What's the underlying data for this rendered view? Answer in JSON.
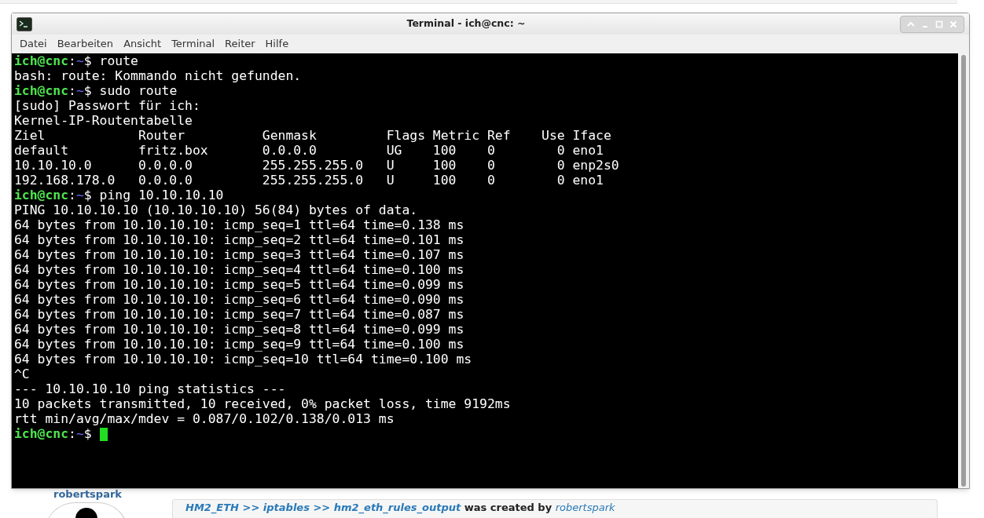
{
  "window": {
    "title": "Terminal - ich@cnc: ~"
  },
  "menu": [
    "Datei",
    "Bearbeiten",
    "Ansicht",
    "Terminal",
    "Reiter",
    "Hilfe"
  ],
  "terminal": {
    "lines": [
      {
        "kind": "prompt",
        "userhost": "ich@cnc",
        "sep": ":",
        "path": "~",
        "symbol": "$",
        "command": " route",
        "cursor": false
      },
      {
        "kind": "output",
        "text": "bash: route: Kommando nicht gefunden."
      },
      {
        "kind": "prompt",
        "userhost": "ich@cnc",
        "sep": ":",
        "path": "~",
        "symbol": "$",
        "command": " sudo route",
        "cursor": false
      },
      {
        "kind": "output",
        "text": "[sudo] Passwort für ich:"
      },
      {
        "kind": "output",
        "text": "Kernel-IP-Routentabelle"
      },
      {
        "kind": "output",
        "text": "Ziel            Router          Genmask         Flags Metric Ref    Use Iface"
      },
      {
        "kind": "output",
        "text": "default         fritz.box       0.0.0.0         UG    100    0        0 eno1"
      },
      {
        "kind": "output",
        "text": "10.10.10.0      0.0.0.0         255.255.255.0   U     100    0        0 enp2s0"
      },
      {
        "kind": "output",
        "text": "192.168.178.0   0.0.0.0         255.255.255.0   U     100    0        0 eno1"
      },
      {
        "kind": "prompt",
        "userhost": "ich@cnc",
        "sep": ":",
        "path": "~",
        "symbol": "$",
        "command": " ping 10.10.10.10",
        "cursor": false
      },
      {
        "kind": "output",
        "text": "PING 10.10.10.10 (10.10.10.10) 56(84) bytes of data."
      },
      {
        "kind": "output",
        "text": "64 bytes from 10.10.10.10: icmp_seq=1 ttl=64 time=0.138 ms"
      },
      {
        "kind": "output",
        "text": "64 bytes from 10.10.10.10: icmp_seq=2 ttl=64 time=0.101 ms"
      },
      {
        "kind": "output",
        "text": "64 bytes from 10.10.10.10: icmp_seq=3 ttl=64 time=0.107 ms"
      },
      {
        "kind": "output",
        "text": "64 bytes from 10.10.10.10: icmp_seq=4 ttl=64 time=0.100 ms"
      },
      {
        "kind": "output",
        "text": "64 bytes from 10.10.10.10: icmp_seq=5 ttl=64 time=0.099 ms"
      },
      {
        "kind": "output",
        "text": "64 bytes from 10.10.10.10: icmp_seq=6 ttl=64 time=0.090 ms"
      },
      {
        "kind": "output",
        "text": "64 bytes from 10.10.10.10: icmp_seq=7 ttl=64 time=0.087 ms"
      },
      {
        "kind": "output",
        "text": "64 bytes from 10.10.10.10: icmp_seq=8 ttl=64 time=0.099 ms"
      },
      {
        "kind": "output",
        "text": "64 bytes from 10.10.10.10: icmp_seq=9 ttl=64 time=0.100 ms"
      },
      {
        "kind": "output",
        "text": "64 bytes from 10.10.10.10: icmp_seq=10 ttl=64 time=0.100 ms"
      },
      {
        "kind": "output",
        "text": "^C"
      },
      {
        "kind": "output",
        "text": "--- 10.10.10.10 ping statistics ---"
      },
      {
        "kind": "output",
        "text": "10 packets transmitted, 10 received, 0% packet loss, time 9192ms"
      },
      {
        "kind": "output",
        "text": "rtt min/avg/max/mdev = 0.087/0.102/0.138/0.013 ms"
      },
      {
        "kind": "prompt",
        "userhost": "ich@cnc",
        "sep": ":",
        "path": "~",
        "symbol": "$",
        "cursor": true
      }
    ]
  },
  "background_page": {
    "author": "robertspark",
    "post_link": "HM2_ETH >> iptables >> hm2_eth_rules_output",
    "post_text": " was created by ",
    "post_author": "robertspark"
  }
}
